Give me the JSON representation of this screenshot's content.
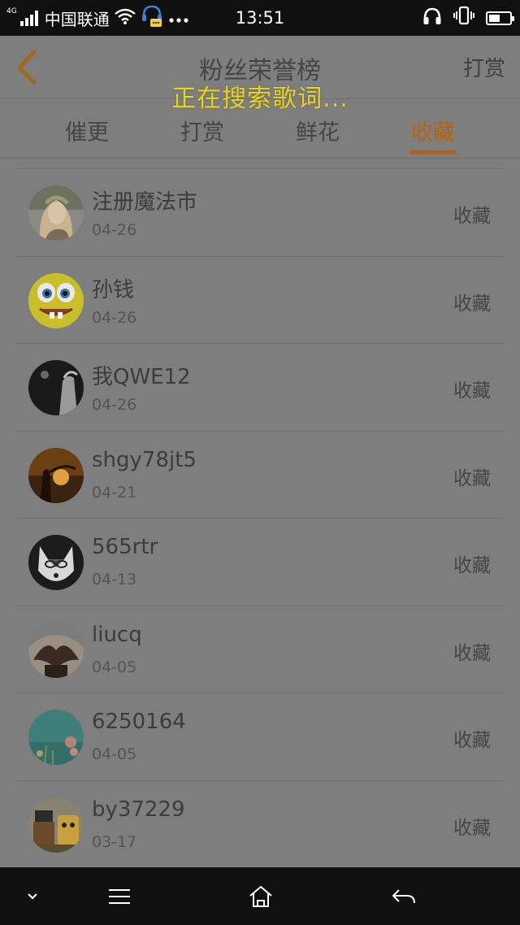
{
  "status_bar": {
    "network_type": "4G",
    "carrier": "中国联通",
    "time": "13:51",
    "icons": [
      "signal-icon",
      "wifi-icon",
      "headset-assistant-icon",
      "more-dots-icon",
      "headphone-icon",
      "vibrate-icon",
      "battery-icon"
    ]
  },
  "header": {
    "title": "粉丝荣誉榜",
    "action_label": "打赏",
    "back_icon": "chevron-left-icon"
  },
  "toast": {
    "text": "正在搜索歌词..."
  },
  "tabs": [
    {
      "label": "催更",
      "active": false
    },
    {
      "label": "打赏",
      "active": false
    },
    {
      "label": "鲜花",
      "active": false
    },
    {
      "label": "收藏",
      "active": true
    }
  ],
  "colors": {
    "accent": "#b8620f",
    "toast": "#e8d21b",
    "overlay_bg": "#7e7e7e",
    "bars": "#101010"
  },
  "list": {
    "items": [
      {
        "name": "注册魔法市",
        "date": "04-26",
        "action": "收藏",
        "avatar": "avatar-woman-portrait"
      },
      {
        "name": "孙钱",
        "date": "04-26",
        "action": "收藏",
        "avatar": "avatar-spongebob"
      },
      {
        "name": "我QWE12",
        "date": "04-26",
        "action": "收藏",
        "avatar": "avatar-dark-figure"
      },
      {
        "name": "shgy78jt5",
        "date": "04-21",
        "action": "收藏",
        "avatar": "avatar-sunset-silhouette"
      },
      {
        "name": "565rtr",
        "date": "04-13",
        "action": "收藏",
        "avatar": "avatar-husky-dog"
      },
      {
        "name": "liucq",
        "date": "04-05",
        "action": "收藏",
        "avatar": "avatar-heart-hands"
      },
      {
        "name": "6250164",
        "date": "04-05",
        "action": "收藏",
        "avatar": "avatar-teal-flowers"
      },
      {
        "name": "by37229",
        "date": "03-17",
        "action": "收藏",
        "avatar": "avatar-cartoon-characters"
      }
    ]
  },
  "nav_bar": {
    "buttons": [
      "chevron-down-icon",
      "menu-icon",
      "home-icon",
      "back-arrow-icon"
    ]
  }
}
